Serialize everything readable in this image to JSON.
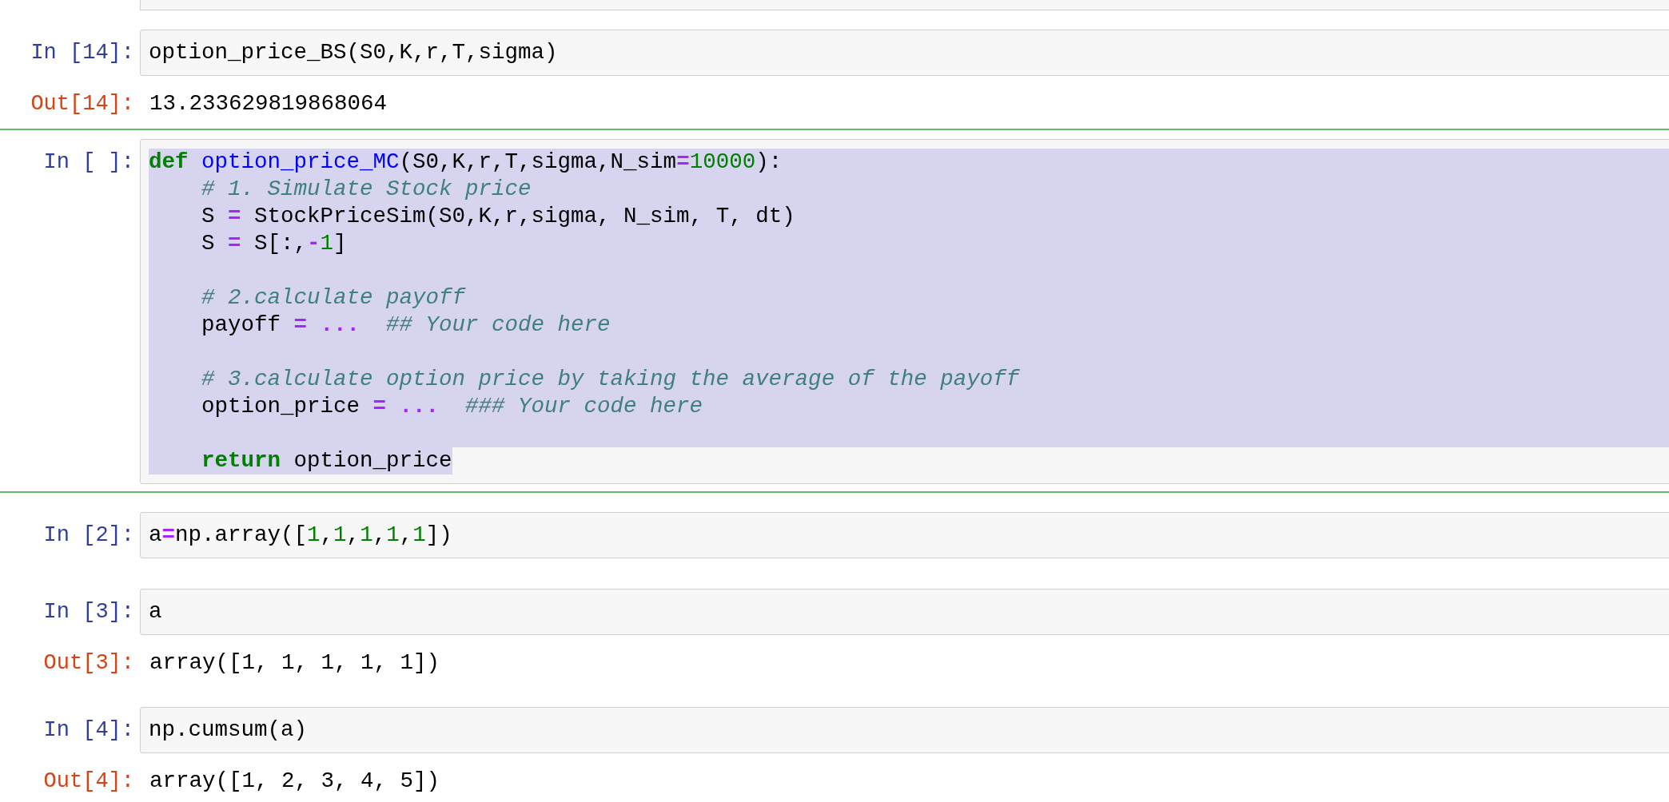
{
  "cells": [
    {
      "prompt": "In [14]:",
      "selected": false,
      "text_selected": false,
      "lines": [
        {
          "tokens": [
            {
              "kind": "plain",
              "t": "option_price_BS(S0,K,r,T,sigma)"
            }
          ]
        }
      ],
      "output": {
        "prompt": "Out[14]:",
        "text": "13.233629819868064"
      }
    },
    {
      "prompt": "In [ ]:",
      "selected": true,
      "text_selected": true,
      "lines": [
        {
          "tokens": [
            {
              "kind": "keyword",
              "t": "def"
            },
            {
              "kind": "defname",
              "t": " option_price_MC"
            },
            {
              "kind": "plain",
              "t": "(S0,K,r,T,sigma,N_sim"
            },
            {
              "kind": "op",
              "t": "="
            },
            {
              "kind": "num",
              "t": "10000"
            },
            {
              "kind": "plain",
              "t": "):"
            }
          ]
        },
        {
          "indent": true,
          "tokens": [
            {
              "kind": "comment",
              "t": "# 1. Simulate Stock price"
            }
          ]
        },
        {
          "indent": true,
          "tokens": [
            {
              "kind": "plain",
              "t": "S "
            },
            {
              "kind": "op",
              "t": "="
            },
            {
              "kind": "plain",
              "t": " StockPriceSim(S0,K,r,sigma, N_sim, T, dt)"
            }
          ]
        },
        {
          "indent": true,
          "tokens": [
            {
              "kind": "plain",
              "t": "S "
            },
            {
              "kind": "op",
              "t": "="
            },
            {
              "kind": "plain",
              "t": " S[:,"
            },
            {
              "kind": "op",
              "t": "-"
            },
            {
              "kind": "num",
              "t": "1"
            },
            {
              "kind": "plain",
              "t": "]"
            }
          ]
        },
        {
          "indent": true,
          "space_before": true,
          "tokens": [
            {
              "kind": "comment",
              "t": "# 2.calculate payoff"
            }
          ]
        },
        {
          "indent": true,
          "tokens": [
            {
              "kind": "plain",
              "t": "payoff "
            },
            {
              "kind": "op",
              "t": "= ...  "
            },
            {
              "kind": "comment",
              "t": "## Your code here"
            }
          ]
        },
        {
          "indent": true,
          "space_before": true,
          "tokens": [
            {
              "kind": "comment",
              "t": "# 3.calculate option price by taking the average of the payoff"
            }
          ]
        },
        {
          "indent": true,
          "tokens": [
            {
              "kind": "plain",
              "t": "option_price "
            },
            {
              "kind": "op",
              "t": "= ...  "
            },
            {
              "kind": "comment",
              "t": "### Your code here"
            }
          ]
        },
        {
          "indent": true,
          "space_before": true,
          "tokens": [
            {
              "kind": "keyword",
              "t": "return"
            },
            {
              "kind": "plain",
              "t": " option_price"
            }
          ]
        }
      ]
    },
    {
      "prompt": "In [2]:",
      "selected": false,
      "text_selected": false,
      "lines": [
        {
          "tokens": [
            {
              "kind": "plain",
              "t": "a"
            },
            {
              "kind": "op",
              "t": "="
            },
            {
              "kind": "plain",
              "t": "np.array(["
            },
            {
              "kind": "num",
              "t": "1"
            },
            {
              "kind": "plain",
              "t": ","
            },
            {
              "kind": "num",
              "t": "1"
            },
            {
              "kind": "plain",
              "t": ","
            },
            {
              "kind": "num",
              "t": "1"
            },
            {
              "kind": "plain",
              "t": ","
            },
            {
              "kind": "num",
              "t": "1"
            },
            {
              "kind": "plain",
              "t": ","
            },
            {
              "kind": "num",
              "t": "1"
            },
            {
              "kind": "plain",
              "t": "])"
            }
          ]
        }
      ]
    },
    {
      "prompt": "In [3]:",
      "selected": false,
      "text_selected": false,
      "lines": [
        {
          "tokens": [
            {
              "kind": "plain",
              "t": "a"
            }
          ]
        }
      ],
      "output": {
        "prompt": "Out[3]:",
        "text": "array([1, 1, 1, 1, 1])"
      }
    },
    {
      "prompt": "In [4]:",
      "selected": false,
      "text_selected": false,
      "lines": [
        {
          "tokens": [
            {
              "kind": "plain",
              "t": "np.cumsum(a)"
            }
          ]
        }
      ],
      "output": {
        "prompt": "Out[4]:",
        "text": "array([1, 2, 3, 4, 5])"
      }
    }
  ]
}
